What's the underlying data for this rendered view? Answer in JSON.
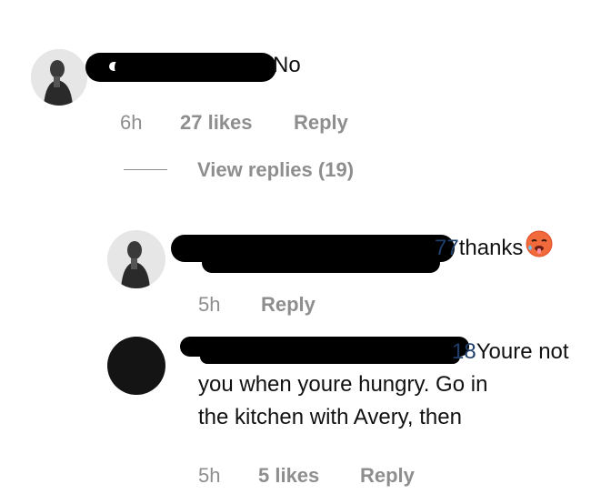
{
  "comment1": {
    "text": "No",
    "time": "6h",
    "likes": "27 likes",
    "reply": "Reply",
    "view_replies": "View replies (19)"
  },
  "reply1": {
    "mention": "77",
    "text": "thanks",
    "emoji": "hot-face",
    "time": "5h",
    "reply": "Reply"
  },
  "reply2": {
    "mention": "18",
    "line1": "Youre not",
    "line2": "you when youre hungry. Go in",
    "line3": "the kitchen with Avery, then",
    "time": "5h",
    "likes": "5 likes",
    "reply": "Reply"
  }
}
